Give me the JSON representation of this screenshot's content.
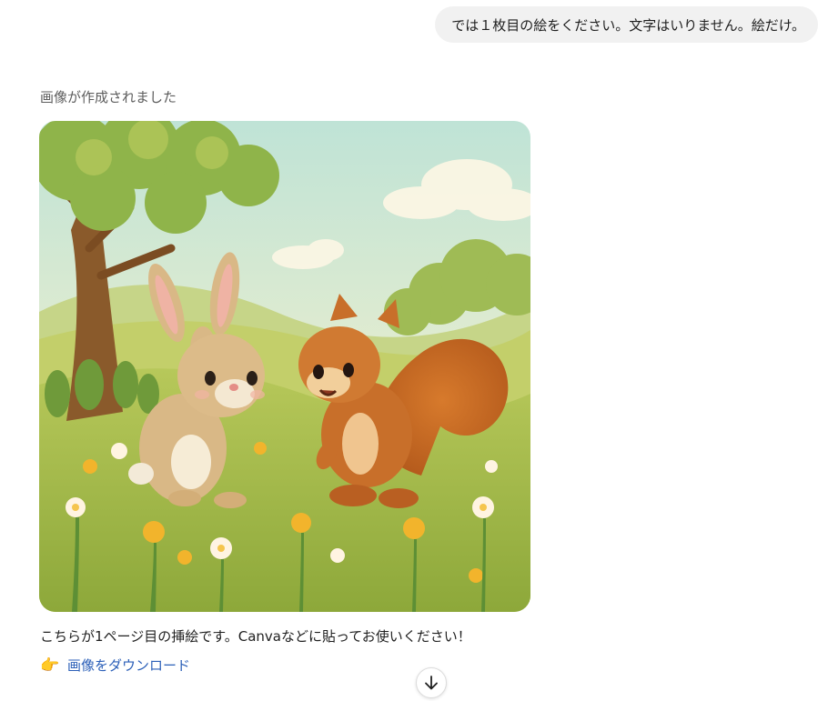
{
  "user_message": {
    "text": "では１枚目の絵をください。文字はいりません。絵だけ。"
  },
  "assistant": {
    "status": "画像が作成されました",
    "image": {
      "subject": "rabbit-and-squirrel-in-meadow"
    },
    "caption": "こちらが1ページ目の挿絵です。Canvaなどに貼ってお使いください！",
    "download": {
      "icon": "pointing-hand-icon",
      "label": "画像をダウンロード"
    }
  },
  "scroll_button": {
    "icon": "arrow-down-icon"
  },
  "colors": {
    "bubble": "#f1f1f1",
    "link": "#2b5fb8",
    "status_text": "#5d5d5d"
  }
}
